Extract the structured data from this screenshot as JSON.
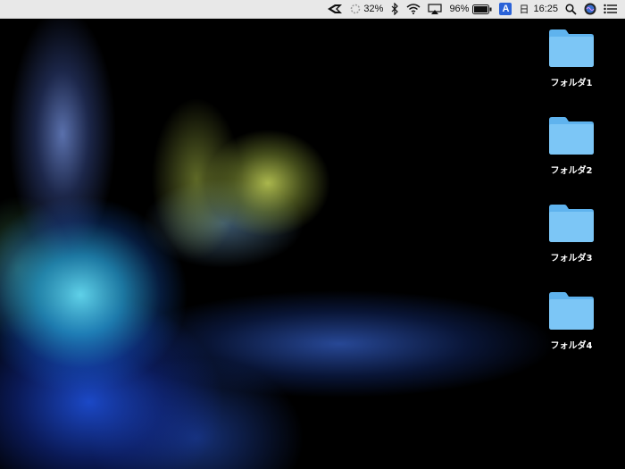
{
  "menubar": {
    "cpu_percent": "32%",
    "battery_percent": "96%",
    "input_method": "A",
    "day": "日",
    "time": "16:25",
    "icons": [
      "status-arrow-icon",
      "cpu-spinner-icon",
      "bluetooth-icon",
      "wifi-icon",
      "airplay-icon",
      "battery-icon",
      "input-method-icon",
      "search-icon",
      "siri-icon",
      "notification-center-icon"
    ]
  },
  "desktop": {
    "folders": [
      {
        "label": "フォルダ1",
        "icon": "folder-icon"
      },
      {
        "label": "フォルダ2",
        "icon": "folder-icon"
      },
      {
        "label": "フォルダ3",
        "icon": "folder-icon"
      },
      {
        "label": "フォルダ4",
        "icon": "folder-icon"
      }
    ]
  },
  "colors": {
    "folder": "#7cc6f6",
    "folder_tab": "#5fb3ee",
    "menubar_bg": "#e8e8e8",
    "ime_badge": "#2a62d8",
    "desktop_bg": "#000000"
  }
}
